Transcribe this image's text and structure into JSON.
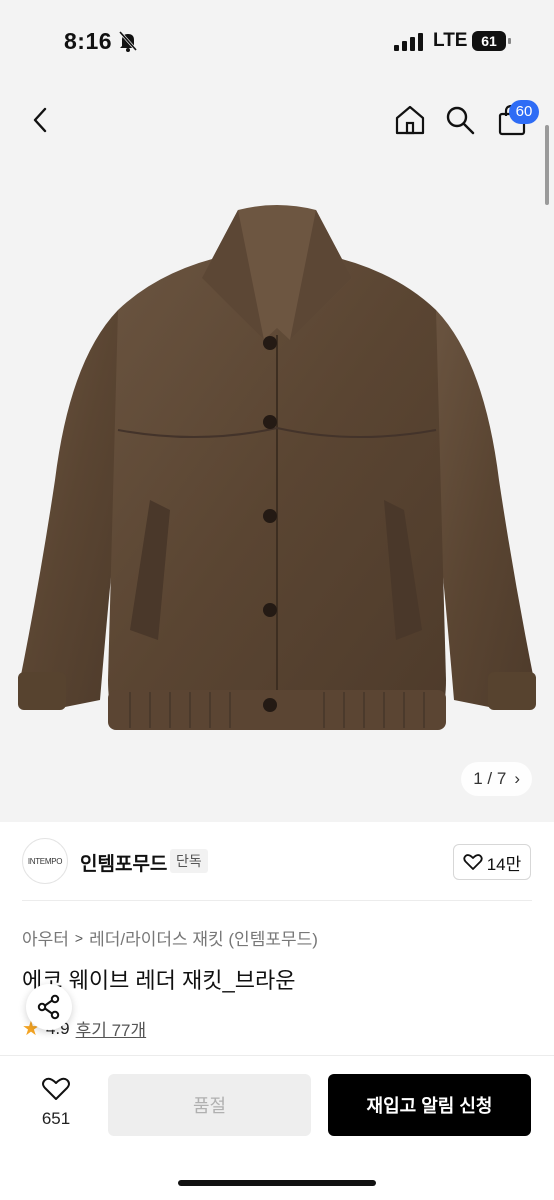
{
  "status_bar": {
    "time": "8:16",
    "network": "LTE",
    "battery": "61"
  },
  "nav": {
    "cart_count": "60"
  },
  "gallery": {
    "current": "1",
    "separator": "/",
    "total": "7",
    "arrow": "›"
  },
  "brand": {
    "logo_text": "INTEMPO",
    "name": "인템포무드",
    "badge": "단독",
    "likes": "14만"
  },
  "product": {
    "breadcrumb": [
      "아우터",
      "레더/라이더스 재킷 (인템포무드)"
    ],
    "breadcrumb_sep": ">",
    "title": "에코 웨이브 레더 재킷_브라운",
    "rating": "4.9",
    "reviews": "후기 77개"
  },
  "bottom_bar": {
    "wish_count": "651",
    "soldout_label": "품절",
    "restock_label": "재입고 알림 신청"
  },
  "colors": {
    "accent_badge": "#2e6cf5",
    "jacket_brown": "#5e4a35",
    "star": "#f4a423",
    "cta": "#000000"
  }
}
